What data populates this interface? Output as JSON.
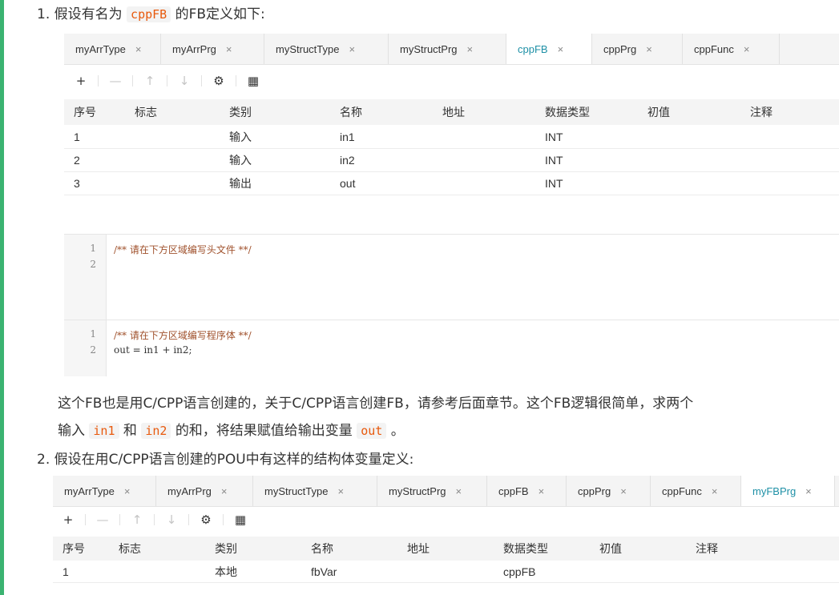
{
  "item1": {
    "num": "1.",
    "pre": "假设有名为",
    "code": "cppFB",
    "post": "的FB定义如下:"
  },
  "item2": {
    "num": "2.",
    "text": "假设在用C/CPP语言创建的POU中有这样的结构体变量定义:"
  },
  "para": {
    "line1": "这个FB也是用C/CPP语言创建的，关于C/CPP语言创建FB，请参考后面章节。这个FB逻辑很简单，求两个",
    "l2_a": "输入",
    "l2_code1": "in1",
    "l2_b": "和",
    "l2_code2": "in2",
    "l2_c": "的和，将结果赋值给输出变量",
    "l2_code3": "out",
    "l2_d": "。"
  },
  "shot1": {
    "tabs": [
      {
        "label": "myArrType",
        "close": "×"
      },
      {
        "label": "myArrPrg",
        "close": "×"
      },
      {
        "label": "myStructType",
        "close": "×"
      },
      {
        "label": "myStructPrg",
        "close": "×"
      },
      {
        "label": "cppFB",
        "close": "×",
        "active": true
      },
      {
        "label": "cppPrg",
        "close": "×"
      },
      {
        "label": "cppFunc",
        "close": "×"
      }
    ],
    "headers": [
      "序号",
      "标志",
      "类别",
      "名称",
      "地址",
      "数据类型",
      "初值",
      "注释"
    ],
    "rows": [
      [
        "1",
        "",
        "输入",
        "in1",
        "",
        "INT",
        "",
        ""
      ],
      [
        "2",
        "",
        "输入",
        "in2",
        "",
        "INT",
        "",
        ""
      ],
      [
        "3",
        "",
        "输出",
        "out",
        "",
        "INT",
        "",
        ""
      ]
    ],
    "editor1": {
      "lines": [
        "1",
        "2"
      ],
      "code": [
        "/** 请在下方区域编写头文件 **/",
        ""
      ]
    },
    "editor2": {
      "lines": [
        "1",
        "2"
      ],
      "code": [
        "/** 请在下方区域编写程序体 **/",
        "out = in1 + in2;"
      ]
    }
  },
  "shot2": {
    "tabs": [
      {
        "label": "myArrType",
        "close": "×"
      },
      {
        "label": "myArrPrg",
        "close": "×"
      },
      {
        "label": "myStructType",
        "close": "×"
      },
      {
        "label": "myStructPrg",
        "close": "×"
      },
      {
        "label": "cppFB",
        "close": "×"
      },
      {
        "label": "cppPrg",
        "close": "×"
      },
      {
        "label": "cppFunc",
        "close": "×"
      },
      {
        "label": "myFBPrg",
        "close": "×",
        "active": true
      }
    ],
    "headers": [
      "序号",
      "标志",
      "类别",
      "名称",
      "地址",
      "数据类型",
      "初值",
      "注释"
    ],
    "rows": [
      [
        "1",
        "",
        "本地",
        "fbVar",
        "",
        "cppFB",
        "",
        ""
      ]
    ]
  },
  "toolbar": {
    "add": "+",
    "remove": "—",
    "up": "↑",
    "down": "↓",
    "settings": "⚙",
    "grid": "▦"
  },
  "colors": {
    "accent": "#1e90a6",
    "code": "#e8590c",
    "bar": "#3bb371"
  }
}
